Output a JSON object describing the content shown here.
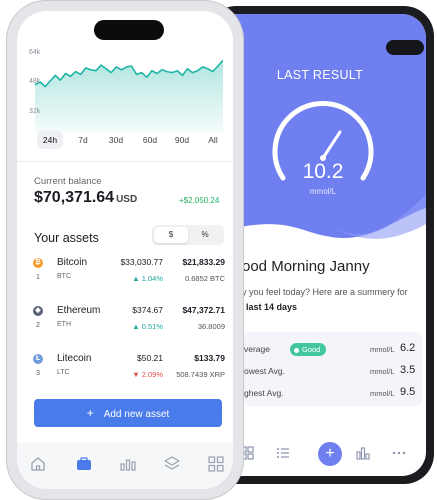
{
  "back_phone": {
    "hero_title": "LAST RESULT",
    "gauge_value": "10.2",
    "gauge_unit": "mmol/L",
    "greeting": "ood Morning Janny",
    "question": "y you feel today? Here are a summery for",
    "period": "last 14 days",
    "stats": [
      {
        "label": "verage",
        "badge": "Good",
        "unit": "mmol/L",
        "value": "6.2"
      },
      {
        "label": "owest Avg.",
        "unit": "mmol/L",
        "value": "3.5"
      },
      {
        "label": "ghest Avg.",
        "unit": "mmol/L",
        "value": "9.5"
      }
    ],
    "nav_icons": [
      "grid-icon",
      "list-icon",
      "plus-icon",
      "bar-chart-icon",
      "more-icon"
    ],
    "fab_label": "+"
  },
  "front_phone": {
    "chart_y_ticks": [
      "64k",
      "48k",
      "32k"
    ],
    "chart_points": [
      46000,
      47500,
      45000,
      48000,
      51000,
      48500,
      52000,
      50500,
      53000,
      51500,
      55000,
      54000,
      53500,
      56500,
      54500,
      52500,
      55500,
      54000,
      55500,
      56000,
      51500,
      52500,
      50000,
      53500,
      52000,
      54000,
      53000,
      52500,
      53500,
      51000,
      54500,
      52500,
      53500,
      55500,
      54500,
      53000,
      56000,
      59000
    ],
    "ranges": [
      "24h",
      "7d",
      "30d",
      "60d",
      "90d",
      "All"
    ],
    "active_range": "24h",
    "balance_label": "Current balance",
    "balance_amount": "$70,371.64",
    "balance_currency": "USD",
    "balance_change": "+$2,050.24",
    "assets_title": "Your assets",
    "toggle_options": [
      "$",
      "%"
    ],
    "assets": [
      {
        "rank": "1",
        "name": "Bitcoin",
        "symbol": "BTC",
        "price": "$33,030.77",
        "change": "▲ 1.04%",
        "holding": "$21,833.29",
        "quantity": "0.6852 BTC",
        "coin_glyph": "₿"
      },
      {
        "rank": "2",
        "name": "Ethereum",
        "symbol": "ETH",
        "price": "$374.67",
        "change": "▲ 0.51%",
        "holding": "$47,372.71",
        "quantity": "36.8009",
        "coin_glyph": "◆"
      },
      {
        "rank": "3",
        "name": "Litecoin",
        "symbol": "LTC",
        "price": "$50.21",
        "change": "▼ 2.09%",
        "holding": "$133.79",
        "quantity": "508.7439 XRP",
        "coin_glyph": "Ł"
      }
    ],
    "add_button": "Add new asset",
    "add_icon": "+",
    "tab_icons": [
      "home-icon",
      "wallet-icon",
      "bar-chart-icon",
      "layers-icon",
      "grid-icon"
    ]
  },
  "colors": {
    "accent_blue": "#4a7bea",
    "hero_purple": "#6f7ff0",
    "chart_line": "#1fb5a6",
    "positive": "#27ae60",
    "negative": "#e34b4b",
    "good_badge": "#42c6a0",
    "bitcoin": "#f49a2a",
    "ethereum": "#5a6275",
    "litecoin": "#6f9ddb"
  }
}
